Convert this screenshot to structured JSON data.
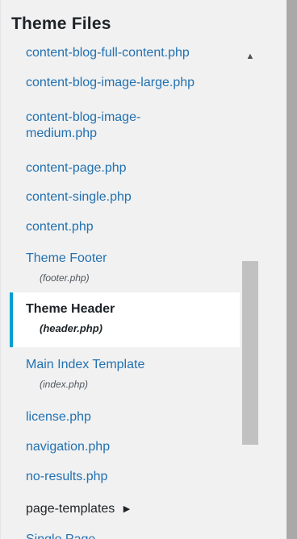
{
  "panel": {
    "title": "Theme Files"
  },
  "files": [
    {
      "label": "content-blog-full-content.php"
    },
    {
      "label": "content-blog-image-large.php"
    },
    {
      "label": "content-blog-image-medium.php",
      "line1": "content-blog-image-",
      "line2": "medium.php"
    },
    {
      "label": "content-page.php"
    },
    {
      "label": "content-single.php"
    },
    {
      "label": "content.php"
    },
    {
      "label": "Theme Footer",
      "sub": "(footer.php)"
    },
    {
      "label": "Theme Header",
      "sub": "(header.php)",
      "active": true
    },
    {
      "label": "Main Index Template",
      "sub": "(index.php)"
    },
    {
      "label": "license.php"
    },
    {
      "label": "navigation.php"
    },
    {
      "label": "no-results.php"
    },
    {
      "label": "page-templates",
      "arrow": "▶"
    },
    {
      "label": "Single Page"
    }
  ],
  "scrollbar": {
    "up_arrow": "▲"
  },
  "colors": {
    "link": "#2271b1",
    "active_border": "#00a0d2",
    "panel_bg": "#f1f1f1",
    "rail": "#a9a9a9"
  }
}
